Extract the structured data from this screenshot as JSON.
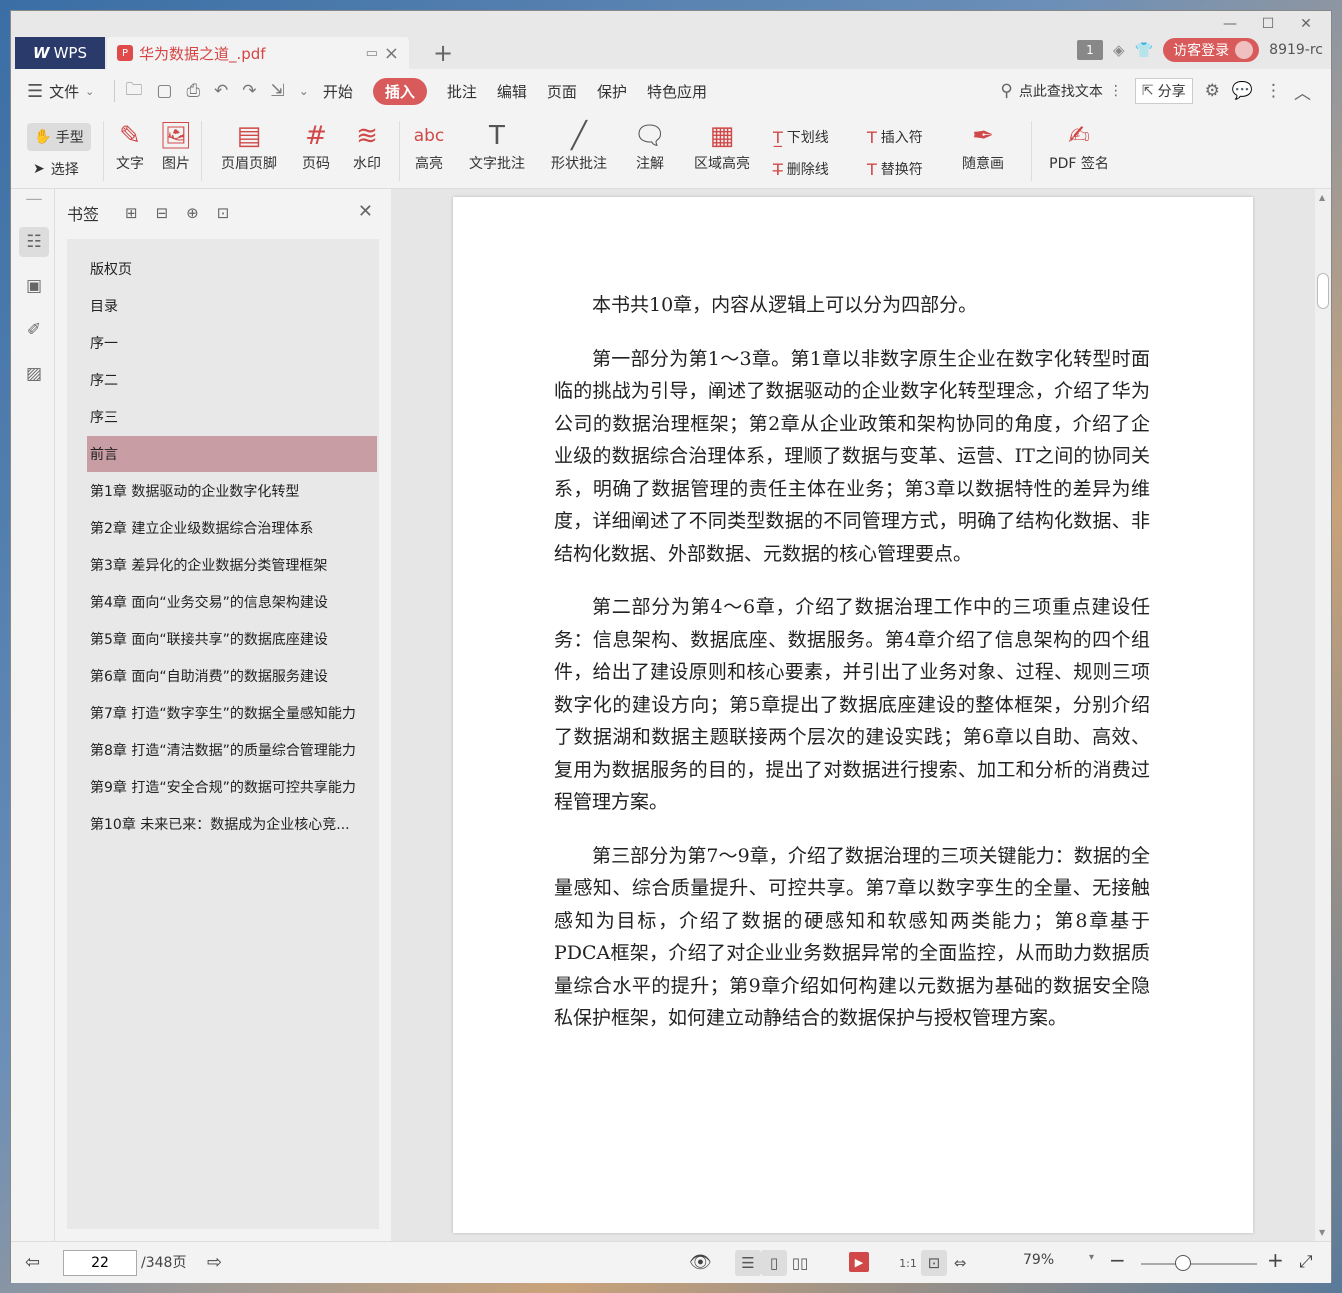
{
  "titlebar": {
    "app_tab": "WPS",
    "doc_tab": "华为数据之道_.pdf",
    "badge": "1",
    "login": "访客登录",
    "version": "8919-rc"
  },
  "menu": {
    "file": "文件",
    "items": [
      "开始",
      "插入",
      "批注",
      "编辑",
      "页面",
      "保护",
      "特色应用"
    ],
    "active": "插入",
    "search": "点此查找文本",
    "share": "分享"
  },
  "ribbon": {
    "hand": "手型",
    "select": "选择",
    "text": "文字",
    "image": "图片",
    "header_footer": "页眉页脚",
    "page_number": "页码",
    "watermark": "水印",
    "highlight": "高亮",
    "text_comment": "文字批注",
    "shape_comment": "形状批注",
    "annotation": "注解",
    "area_highlight": "区域高亮",
    "underline": "下划线",
    "strikethrough": "删除线",
    "insert_mark": "插入符",
    "replace_mark": "替换符",
    "freehand": "随意画",
    "pdf_sign": "PDF 签名"
  },
  "bookmarks": {
    "title": "书签",
    "items": [
      "版权页",
      "目录",
      "序一",
      "序二",
      "序三",
      "前言",
      "第1章 数据驱动的企业数字化转型",
      "第2章 建立企业级数据综合治理体系",
      "第3章 差异化的企业数据分类管理框架",
      "第4章 面向“业务交易”的信息架构建设",
      "第5章 面向“联接共享”的数据底座建设",
      "第6章 面向“自助消费”的数据服务建设",
      "第7章 打造“数字孪生”的数据全量感知能力",
      "第8章 打造“清洁数据”的质量综合管理能力",
      "第9章 打造“安全合规”的数据可控共享能力",
      "第10章 未来已来：数据成为企业核心竞..."
    ],
    "selected_index": 5
  },
  "document": {
    "paragraphs": [
      "本书共10章，内容从逻辑上可以分为四部分。",
      "第一部分为第1～3章。第1章以非数字原生企业在数字化转型时面临的挑战为引导，阐述了数据驱动的企业数字化转型理念，介绍了华为公司的数据治理框架；第2章从企业政策和架构协同的角度，介绍了企业级的数据综合治理体系，理顺了数据与变革、运营、IT之间的协同关系，明确了数据管理的责任主体在业务；第3章以数据特性的差异为维度，详细阐述了不同类型数据的不同管理方式，明确了结构化数据、非结构化数据、外部数据、元数据的核心管理要点。",
      "第二部分为第4～6章，介绍了数据治理工作中的三项重点建设任务：信息架构、数据底座、数据服务。第4章介绍了信息架构的四个组件，给出了建设原则和核心要素，并引出了业务对象、过程、规则三项数字化的建设方向；第5章提出了数据底座建设的整体框架，分别介绍了数据湖和数据主题联接两个层次的建设实践；第6章以自助、高效、复用为数据服务的目的，提出了对数据进行搜索、加工和分析的消费过程管理方案。",
      "第三部分为第7～9章，介绍了数据治理的三项关键能力：数据的全量感知、综合质量提升、可控共享。第7章以数字孪生的全量、无接触感知为目标，介绍了数据的硬感知和软感知两类能力；第8章基于PDCA框架，介绍了对企业业务数据异常的全面监控，从而助力数据质量综合水平的提升；第9章介绍如何构建以元数据为基础的数据安全隐私保护框架，如何建立动静结合的数据保护与授权管理方案。"
    ]
  },
  "status": {
    "page": "22",
    "total": "/348页",
    "zoom": "79%"
  }
}
